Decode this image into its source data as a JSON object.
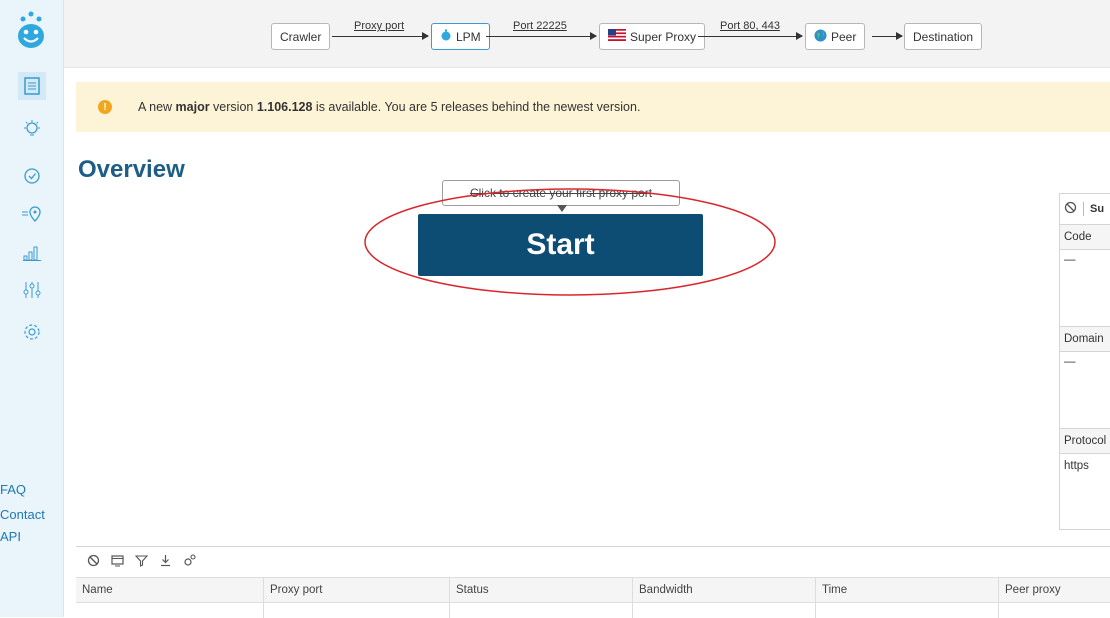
{
  "flow": {
    "nodes": [
      "Crawler",
      "LPM",
      "Super Proxy",
      "Peer",
      "Destination"
    ],
    "links": [
      "Proxy port",
      "Port 22225",
      "Port 80, 443"
    ]
  },
  "sidebar": {
    "links": [
      "FAQ",
      "Contact",
      "API"
    ]
  },
  "notice": {
    "pre": "A new ",
    "bold1": "major",
    "mid": " version ",
    "bold2": "1.106.128",
    "post": " is available. You are 5 releases behind the newest version."
  },
  "page": {
    "title": "Overview",
    "tooltip": "Click to create your first proxy port",
    "start_label": "Start"
  },
  "right_panel": {
    "toolbar_text": "Su",
    "sections": [
      {
        "label": "Code",
        "value": "—"
      },
      {
        "label": "Domain",
        "value": "—"
      },
      {
        "label": "Protocol",
        "value": "https"
      }
    ]
  },
  "table": {
    "columns": [
      "Name",
      "Proxy port",
      "Status",
      "Bandwidth",
      "Time",
      "Peer proxy"
    ]
  },
  "colors": {
    "accent": "#0e4d73",
    "title": "#1d5e86",
    "notice_bg": "#fdf3d7",
    "sidebar_bg": "#e9f5fb",
    "highlight": "#d9262c"
  }
}
